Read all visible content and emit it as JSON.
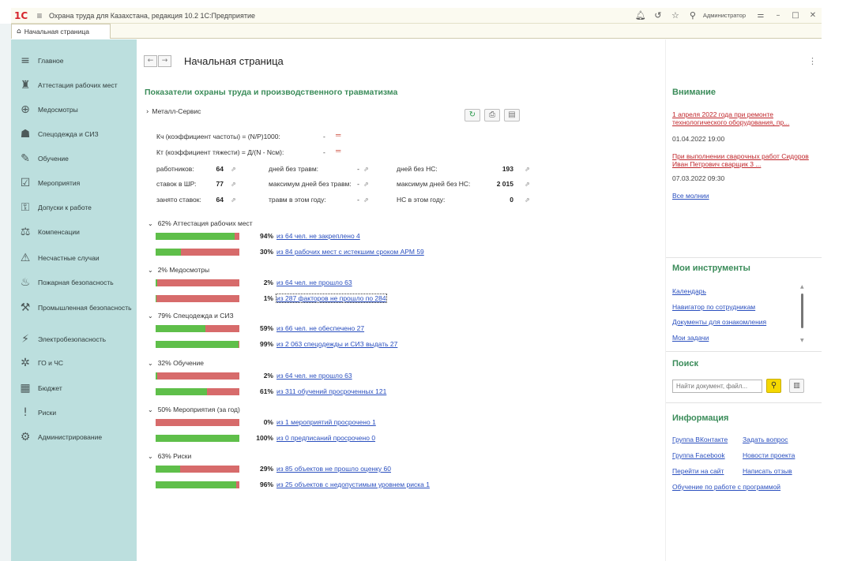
{
  "window": {
    "title": "Охрана труда для Казахстана, редакция 10.2 1С:Предприятие",
    "user": "Администратор",
    "logo": "1С",
    "icons": [
      "bell-icon",
      "history-icon",
      "star-icon",
      "search-icon"
    ]
  },
  "tabs": [
    {
      "label": "Начальная страница"
    }
  ],
  "sidebar": {
    "items": [
      {
        "label": "Главное",
        "icon": "≡"
      },
      {
        "label": "Аттестация рабочих мест",
        "icon": "♜"
      },
      {
        "label": "Медосмотры",
        "icon": "⊕"
      },
      {
        "label": "Спецодежда и СИЗ",
        "icon": "☗"
      },
      {
        "label": "Обучение",
        "icon": "✎"
      },
      {
        "label": "Мероприятия",
        "icon": "☑"
      },
      {
        "label": "Допуски к работе",
        "icon": "⚿"
      },
      {
        "label": "Компенсации",
        "icon": "⚖"
      },
      {
        "label": "Несчастные случаи",
        "icon": "⚠"
      },
      {
        "label": "Пожарная безопасность",
        "icon": "♨"
      },
      {
        "label": "Промышленная безопасность",
        "icon": "⚒"
      },
      {
        "label": "Электробезопасность",
        "icon": "⚡"
      },
      {
        "label": "ГО и ЧС",
        "icon": "✲"
      },
      {
        "label": "Бюджет",
        "icon": "▦"
      },
      {
        "label": "Риски",
        "icon": "!"
      },
      {
        "label": "Администрирование",
        "icon": "⚙"
      }
    ]
  },
  "main": {
    "page_title": "Начальная страница",
    "section_title": "Показатели охраны труда и производственного травматизма",
    "organization": "Металл-Сервис",
    "coefficients": [
      {
        "label": "Кч (коэффициент частоты) = (N/P)1000:",
        "value": "-"
      },
      {
        "label": "Кт (коэффициент тяжести) = Д/(N - Nсм):",
        "value": "-"
      }
    ],
    "stats": [
      [
        {
          "label": "работников:",
          "value": "64"
        },
        {
          "label": "дней без травм:",
          "value": "-"
        },
        {
          "label": "дней без НС:",
          "value": "193"
        }
      ],
      [
        {
          "label": "ставок в ШР:",
          "value": "77"
        },
        {
          "label": "максимум дней без травм:",
          "value": "-"
        },
        {
          "label": "максимум дней без НС:",
          "value": "2 015"
        }
      ],
      [
        {
          "label": "занято ставок:",
          "value": "64"
        },
        {
          "label": "травм в этом году:",
          "value": "-"
        },
        {
          "label": "НС в этом году:",
          "value": "0"
        }
      ]
    ],
    "groups": [
      {
        "header": "62% Аттестация рабочих мест",
        "rows": [
          {
            "fill": 0.94,
            "pct": "94%",
            "link": "из 64 чел. не закреплено 4"
          },
          {
            "fill": 0.3,
            "pct": "30%",
            "link": "из 84 рабочих мест с истекшим сроком АРМ 59"
          }
        ]
      },
      {
        "header": "2% Медосмотры",
        "rows": [
          {
            "fill": 0.02,
            "pct": "2%",
            "link": "из 64 чел. не прошло 63"
          },
          {
            "fill": 0.01,
            "pct": "1%",
            "link": "из 287 факторов не прошло по 284"
          }
        ]
      },
      {
        "header": "79% Спецодежда и СИЗ",
        "rows": [
          {
            "fill": 0.59,
            "pct": "59%",
            "link": "из 66 чел. не обеспечено 27"
          },
          {
            "fill": 0.99,
            "pct": "99%",
            "link": "из 2 063 спецодежды и СИЗ выдать 27"
          }
        ]
      },
      {
        "header": "32% Обучение",
        "rows": [
          {
            "fill": 0.02,
            "pct": "2%",
            "link": "из 64 чел. не прошло 63"
          },
          {
            "fill": 0.61,
            "pct": "61%",
            "link": "из 311 обучений просроченных 121"
          }
        ]
      },
      {
        "header": "50% Мероприятия (за год)",
        "rows": [
          {
            "fill": 0.0,
            "pct": "0%",
            "link": "из 1 мероприятий просрочено 1"
          },
          {
            "fill": 1.0,
            "pct": "100%",
            "link": "из 0 предписаний просрочено 0"
          }
        ]
      },
      {
        "header": "63% Риски",
        "rows": [
          {
            "fill": 0.29,
            "pct": "29%",
            "link": "из 85 объектов не прошло оценку 60"
          },
          {
            "fill": 0.96,
            "pct": "96%",
            "link": "из 25 объектов с недопустимым уровнем риска 1"
          }
        ]
      }
    ]
  },
  "right": {
    "attention": {
      "title": "Внимание",
      "items": [
        {
          "text": "1 апреля 2022 года при ремонте технологического оборудования, пр...",
          "date": "01.04.2022 19:00"
        },
        {
          "text": "При выполнении сварочных работ Сидоров Иван Петрович сварщик 3 ...",
          "date": "07.03.2022 09:30"
        }
      ],
      "all_link": "Все молнии"
    },
    "tools": {
      "title": "Мои инструменты",
      "links": [
        "Календарь",
        "Навигатор по сотрудникам",
        "Документы для ознакомления",
        "Мои задачи"
      ]
    },
    "search": {
      "title": "Поиск",
      "placeholder": "Найти документ, файл..."
    },
    "info": {
      "title": "Информация",
      "links": [
        [
          "Группа ВКонтакте",
          "Задать вопрос"
        ],
        [
          "Группа Facebook",
          "Новости проекта"
        ],
        [
          "Перейти на сайт",
          "Написать отзыв"
        ],
        [
          "Обучение по работе с программой"
        ]
      ]
    }
  },
  "colors": {
    "accent": "#3b8c5a",
    "sidebar": "#bcdfde",
    "bar_green": "#5fbf4a",
    "bar_red": "#d76b6b",
    "link": "#2a4fbf",
    "alert": "#c0262b"
  }
}
